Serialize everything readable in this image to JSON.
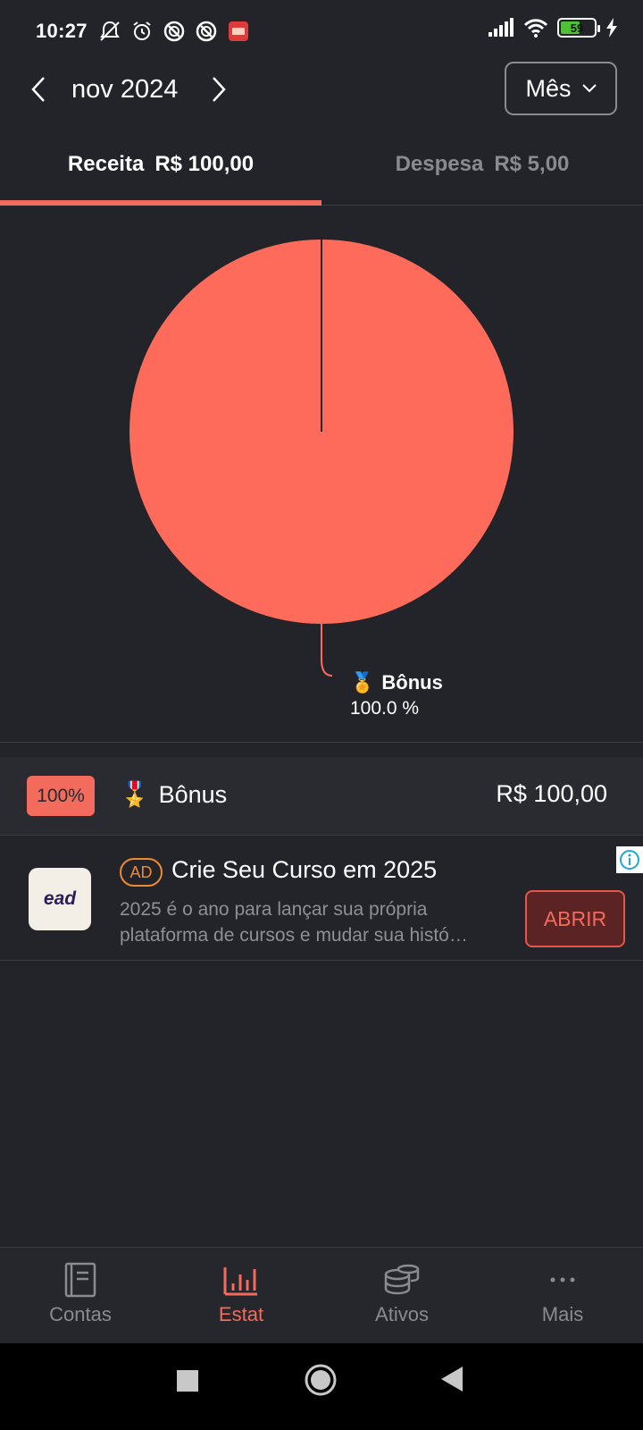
{
  "status_bar": {
    "time": "10:27",
    "battery_level": "59",
    "battery_fraction": 0.59
  },
  "header": {
    "period": "nov 2024",
    "period_select": "Mês"
  },
  "tabs": [
    {
      "label": "Receita",
      "amount": "R$ 100,00",
      "active": true
    },
    {
      "label": "Despesa",
      "amount": "R$ 5,00",
      "active": false
    }
  ],
  "colors": {
    "accent": "#f26b5c",
    "background": "#232429",
    "muted": "#8a8b90"
  },
  "chart_data": {
    "type": "pie",
    "slices": [
      {
        "label": "Bônus",
        "value": 100.0,
        "percent": "100.0 %",
        "color": "#ff6b5b"
      }
    ]
  },
  "list": [
    {
      "percent": "100%",
      "category": "Bônus",
      "icon": "medal-icon",
      "amount": "R$ 100,00"
    }
  ],
  "ad": {
    "badge": "AD",
    "title": "Crie Seu Curso em 2025",
    "description_line1": "2025 é o ano para lançar sua própria",
    "description_line2": "plataforma de cursos e mudar sua histó…",
    "button": "ABRIR",
    "logo_text": "ead"
  },
  "bottom_nav": [
    {
      "label": "Contas",
      "icon": "book-icon",
      "active": false
    },
    {
      "label": "Estat",
      "icon": "bar-chart-icon",
      "active": true
    },
    {
      "label": "Ativos",
      "icon": "coins-icon",
      "active": false
    },
    {
      "label": "Mais",
      "icon": "more-icon",
      "active": false
    }
  ]
}
